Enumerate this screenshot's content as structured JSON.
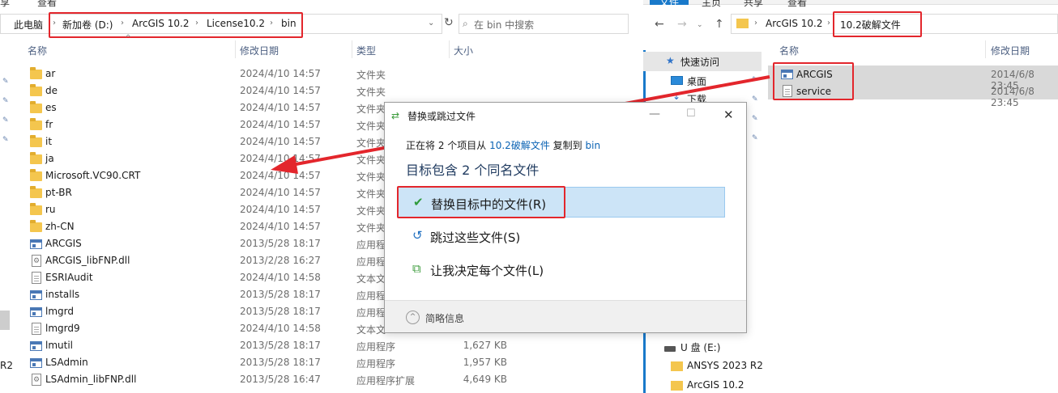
{
  "left": {
    "ribbon": {
      "share": "享",
      "view": "查看"
    },
    "address": [
      "此电脑",
      "新加卷 (D:)",
      "ArcGIS 10.2",
      "License10.2",
      "bin"
    ],
    "search_placeholder": "在 bin 中搜索",
    "columns": {
      "name": "名称",
      "date": "修改日期",
      "type": "类型",
      "size": "大小"
    },
    "rows": [
      {
        "name": "ar",
        "date": "2024/4/10 14:57",
        "type": "文件夹",
        "size": "",
        "icon": "folder"
      },
      {
        "name": "de",
        "date": "2024/4/10 14:57",
        "type": "文件夹",
        "size": "",
        "icon": "folder"
      },
      {
        "name": "es",
        "date": "2024/4/10 14:57",
        "type": "文件夹",
        "size": "",
        "icon": "folder"
      },
      {
        "name": "fr",
        "date": "2024/4/10 14:57",
        "type": "文件夹",
        "size": "",
        "icon": "folder"
      },
      {
        "name": "it",
        "date": "2024/4/10 14:57",
        "type": "文件夹",
        "size": "",
        "icon": "folder"
      },
      {
        "name": "ja",
        "date": "2024/4/10 14:57",
        "type": "文件夹",
        "size": "",
        "icon": "folder"
      },
      {
        "name": "Microsoft.VC90.CRT",
        "date": "2024/4/10 14:57",
        "type": "文件夹",
        "size": "",
        "icon": "folder"
      },
      {
        "name": "pt-BR",
        "date": "2024/4/10 14:57",
        "type": "文件夹",
        "size": "",
        "icon": "folder"
      },
      {
        "name": "ru",
        "date": "2024/4/10 14:57",
        "type": "文件夹",
        "size": "",
        "icon": "folder"
      },
      {
        "name": "zh-CN",
        "date": "2024/4/10 14:57",
        "type": "文件夹",
        "size": "",
        "icon": "folder"
      },
      {
        "name": "ARCGIS",
        "date": "2013/5/28 18:17",
        "type": "应用程",
        "size": "",
        "icon": "exe"
      },
      {
        "name": "ARCGIS_libFNP.dll",
        "date": "2013/2/28 16:27",
        "type": "应用程",
        "size": "",
        "icon": "dll"
      },
      {
        "name": "ESRIAudit",
        "date": "2024/4/10 14:58",
        "type": "文本文",
        "size": "",
        "icon": "file"
      },
      {
        "name": "installs",
        "date": "2013/5/28 18:17",
        "type": "应用程",
        "size": "",
        "icon": "exe"
      },
      {
        "name": "lmgrd",
        "date": "2013/5/28 18:17",
        "type": "应用程",
        "size": "",
        "icon": "exe"
      },
      {
        "name": "lmgrd9",
        "date": "2024/4/10 14:58",
        "type": "文本文",
        "size": "",
        "icon": "file"
      },
      {
        "name": "lmutil",
        "date": "2013/5/28 18:17",
        "type": "应用程序",
        "size": "1,627 KB",
        "icon": "exe"
      },
      {
        "name": "LSAdmin",
        "date": "2013/5/28 18:17",
        "type": "应用程序",
        "size": "1,957 KB",
        "icon": "exe"
      },
      {
        "name": "LSAdmin_libFNP.dll",
        "date": "2013/5/28 16:47",
        "type": "应用程序扩展",
        "size": "4,649 KB",
        "icon": "dll"
      }
    ],
    "edge_label": "R2"
  },
  "right": {
    "ribbon": {
      "file": "文件",
      "home": "主页",
      "share": "共享",
      "view": "查看"
    },
    "address": [
      "ArcGIS 10.2",
      "10.2破解文件"
    ],
    "columns": {
      "name": "名称",
      "date": "修改日期"
    },
    "nav": {
      "quick_access": "快速访问",
      "desktop": "桌面",
      "downloads": "下载",
      "u_disk": "U 盘 (E:)",
      "ansys": "ANSYS 2023 R2",
      "arcgis": "ArcGIS 10.2"
    },
    "files": [
      {
        "name": "ARCGIS",
        "date": "2014/6/8 23:45",
        "icon": "exe"
      },
      {
        "name": "service",
        "date": "2014/6/8 23:45",
        "icon": "file"
      }
    ]
  },
  "dialog": {
    "title": "替换或跳过文件",
    "line_prefix": "正在将 2 个项目从",
    "source": "10.2破解文件",
    "line_mid": "复制到",
    "dest": "bin",
    "heading": "目标包含 2 个同名文件",
    "options": [
      {
        "label": "替换目标中的文件(R)",
        "icon": "check-icon"
      },
      {
        "label": "跳过这些文件(S)",
        "icon": "skip-icon"
      },
      {
        "label": "让我决定每个文件(L)",
        "icon": "decide-icon"
      }
    ],
    "footer": "简略信息"
  },
  "colors": {
    "annotation_red": "#e3262c",
    "selection": "#cce4f7",
    "link": "#0b63b4"
  }
}
